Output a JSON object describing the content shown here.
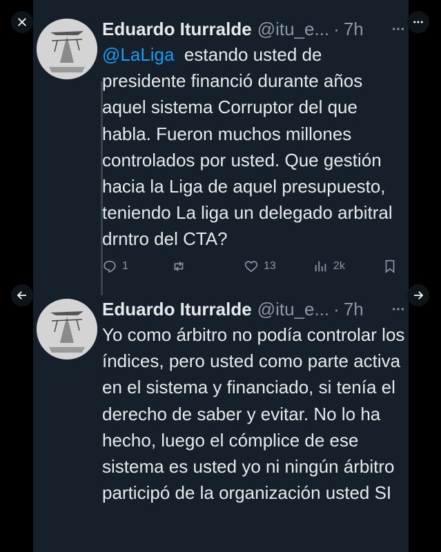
{
  "overlay": {
    "close_icon": "close-icon",
    "more_icon": "more-horizontal-icon",
    "prev_icon": "arrow-left-icon",
    "next_icon": "arrow-right-icon"
  },
  "tweets": [
    {
      "author_name": "Eduardo Iturralde",
      "handle": "@itu_e...",
      "dot": "·",
      "time": "7h",
      "mention": "@LaLiga",
      "text": "  estando usted de presidente financió durante años aquel sistema Corruptor del que habla. Fueron muchos millones controlados por usted. Que gestión hacia la Liga de aquel presupuesto, teniendo La liga un delegado arbitral drntro del CTA?",
      "replies": "1",
      "retweets": "",
      "likes": "13",
      "views": "2k"
    },
    {
      "author_name": "Eduardo Iturralde",
      "handle": "@itu_e...",
      "dot": "·",
      "time": "7h",
      "text": "Yo como árbitro no podía controlar los índices, pero usted como parte activa en el sistema y financiado, si tenía el derecho de saber y evitar. No lo ha hecho, luego el cómplice de ese sistema es usted yo ni ningún árbitro participó de la organización usted SI"
    }
  ],
  "colors": {
    "background": "#15202b",
    "text": "#e7e9ea",
    "muted": "#8b98a5",
    "accent": "#1d9bf0"
  }
}
